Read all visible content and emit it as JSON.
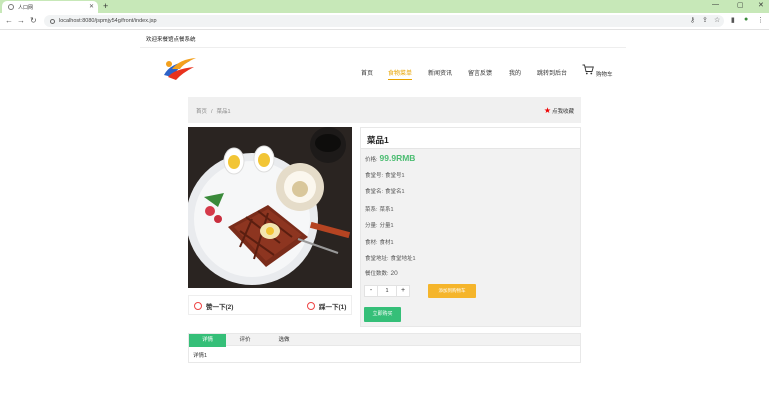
{
  "browser": {
    "tab_title": "人口网",
    "new_tab": "+",
    "url": "localhost:8080/jspmjy54g/front/index.jsp",
    "window_controls": [
      "—",
      "▢",
      "✕"
    ]
  },
  "page": {
    "welcome": "欢迎来餐馆点餐系统",
    "nav": [
      "首页",
      "食物菜单",
      "新闻资讯",
      "留言反馈",
      "我的",
      "跳转到后台"
    ],
    "cart_label": "购物车",
    "breadcrumb": [
      "首页",
      "菜品1"
    ],
    "favorite_label": "点我收藏",
    "vote": {
      "like": "赞一下(2)",
      "dislike": "踩一下(1)"
    },
    "product": {
      "title": "菜品1",
      "price_label": "价格:",
      "price": "99.9RMB",
      "rows": [
        {
          "label": "食堂号:",
          "value": "食堂号1"
        },
        {
          "label": "食堂名:",
          "value": "食堂名1"
        },
        {
          "label": "菜系:",
          "value": "菜系1"
        },
        {
          "label": "分量:",
          "value": "分量1"
        },
        {
          "label": "食材:",
          "value": "食材1"
        },
        {
          "label": "食堂地址:",
          "value": "食堂地址1"
        }
      ],
      "stock_label": "餐位数数:",
      "stock": "20"
    },
    "stepper": {
      "minus": "-",
      "qty": "1",
      "plus": "+"
    },
    "add_cart": "添加到购物车",
    "buy_now": "立即购买",
    "tabs": [
      "详情",
      "评价",
      "选做"
    ],
    "detail": "详情1"
  }
}
